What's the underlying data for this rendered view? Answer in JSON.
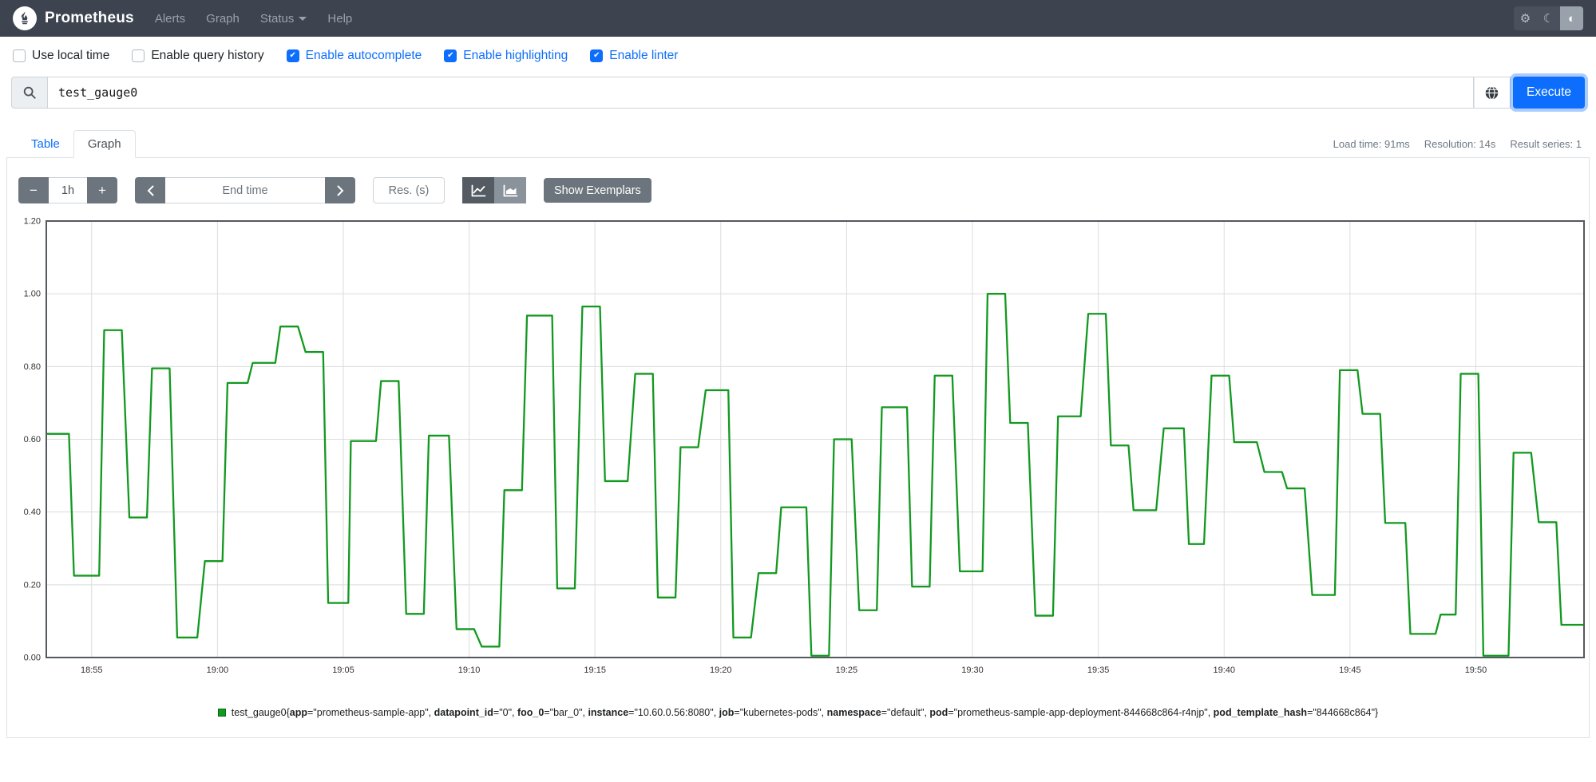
{
  "navbar": {
    "brand": "Prometheus",
    "items": [
      {
        "label": "Alerts"
      },
      {
        "label": "Graph"
      },
      {
        "label": "Status",
        "has_caret": true
      },
      {
        "label": "Help"
      }
    ],
    "theme_buttons": [
      {
        "icon": "gear-icon",
        "glyph": "⚙",
        "active": false
      },
      {
        "icon": "moon-icon",
        "glyph": "☾",
        "active": false
      },
      {
        "icon": "contrast-icon",
        "glyph": "◐",
        "active": true
      }
    ]
  },
  "options": {
    "items": [
      {
        "label": "Use local time",
        "checked": false
      },
      {
        "label": "Enable query history",
        "checked": false
      },
      {
        "label": "Enable autocomplete",
        "checked": true
      },
      {
        "label": "Enable highlighting",
        "checked": true
      },
      {
        "label": "Enable linter",
        "checked": true
      }
    ]
  },
  "query": {
    "value": "test_gauge0",
    "execute_label": "Execute"
  },
  "tabs": [
    {
      "label": "Table",
      "active": false
    },
    {
      "label": "Graph",
      "active": true
    }
  ],
  "stats": {
    "load_time": "Load time: 91ms",
    "resolution": "Resolution: 14s",
    "result_series": "Result series: 1"
  },
  "controls": {
    "minus": "−",
    "range_value": "1h",
    "plus": "+",
    "prev": "‹",
    "end_time_placeholder": "End time",
    "next": "›",
    "res_placeholder": "Res. (s)",
    "show_exemplars": "Show Exemplars"
  },
  "chart_data": {
    "type": "line",
    "step": true,
    "title": "",
    "xlabel": "",
    "ylabel": "",
    "grid": true,
    "legend_position": "bottom-center",
    "xlim_minutes_after_1850": [
      3.2,
      64.3
    ],
    "ylim": [
      0,
      1.2
    ],
    "y_ticks": [
      0,
      0.2,
      0.4,
      0.6,
      0.8,
      1.0,
      1.2
    ],
    "x_ticks": [
      {
        "min": 5,
        "label": "18:55"
      },
      {
        "min": 10,
        "label": "19:00"
      },
      {
        "min": 15,
        "label": "19:05"
      },
      {
        "min": 20,
        "label": "19:10"
      },
      {
        "min": 25,
        "label": "19:15"
      },
      {
        "min": 30,
        "label": "19:20"
      },
      {
        "min": 35,
        "label": "19:25"
      },
      {
        "min": 40,
        "label": "19:30"
      },
      {
        "min": 45,
        "label": "19:35"
      },
      {
        "min": 50,
        "label": "19:40"
      },
      {
        "min": 55,
        "label": "19:45"
      },
      {
        "min": 60,
        "label": "19:50"
      }
    ],
    "series": [
      {
        "name": "test_gauge0",
        "color": "#12991f",
        "segments_start_end_value": [
          [
            3.2,
            4.1,
            0.615
          ],
          [
            4.3,
            5.3,
            0.225
          ],
          [
            5.5,
            6.2,
            0.9
          ],
          [
            6.5,
            7.2,
            0.385
          ],
          [
            7.4,
            8.1,
            0.795
          ],
          [
            8.4,
            9.2,
            0.055
          ],
          [
            9.5,
            10.2,
            0.265
          ],
          [
            10.4,
            11.2,
            0.755
          ],
          [
            11.4,
            12.3,
            0.81
          ],
          [
            12.5,
            13.2,
            0.91
          ],
          [
            13.5,
            14.2,
            0.84
          ],
          [
            14.4,
            15.2,
            0.15
          ],
          [
            15.3,
            16.3,
            0.595
          ],
          [
            16.5,
            17.2,
            0.76
          ],
          [
            17.5,
            18.2,
            0.12
          ],
          [
            18.4,
            19.2,
            0.61
          ],
          [
            19.5,
            20.2,
            0.078
          ],
          [
            20.5,
            21.2,
            0.03
          ],
          [
            21.4,
            22.1,
            0.46
          ],
          [
            22.3,
            23.3,
            0.94
          ],
          [
            23.5,
            24.2,
            0.19
          ],
          [
            24.5,
            25.2,
            0.965
          ],
          [
            25.4,
            26.3,
            0.485
          ],
          [
            26.6,
            27.3,
            0.78
          ],
          [
            27.5,
            28.2,
            0.165
          ],
          [
            28.4,
            29.1,
            0.578
          ],
          [
            29.4,
            30.3,
            0.735
          ],
          [
            30.5,
            31.2,
            0.055
          ],
          [
            31.5,
            32.2,
            0.232
          ],
          [
            32.4,
            33.4,
            0.413
          ],
          [
            33.6,
            34.3,
            0.005
          ],
          [
            34.5,
            35.2,
            0.6
          ],
          [
            35.5,
            36.2,
            0.13
          ],
          [
            36.4,
            37.4,
            0.688
          ],
          [
            37.6,
            38.3,
            0.195
          ],
          [
            38.5,
            39.2,
            0.775
          ],
          [
            39.5,
            40.4,
            0.237
          ],
          [
            40.6,
            41.3,
            1.0
          ],
          [
            41.5,
            42.2,
            0.645
          ],
          [
            42.5,
            43.2,
            0.115
          ],
          [
            43.4,
            44.3,
            0.663
          ],
          [
            44.6,
            45.3,
            0.945
          ],
          [
            45.5,
            46.2,
            0.583
          ],
          [
            46.4,
            47.3,
            0.405
          ],
          [
            47.6,
            48.4,
            0.63
          ],
          [
            48.6,
            49.2,
            0.312
          ],
          [
            49.5,
            50.2,
            0.775
          ],
          [
            50.4,
            51.3,
            0.592
          ],
          [
            51.6,
            52.3,
            0.51
          ],
          [
            52.5,
            53.2,
            0.465
          ],
          [
            53.5,
            54.4,
            0.172
          ],
          [
            54.6,
            55.3,
            0.79
          ],
          [
            55.5,
            56.2,
            0.67
          ],
          [
            56.4,
            57.2,
            0.37
          ],
          [
            57.4,
            58.4,
            0.065
          ],
          [
            58.6,
            59.2,
            0.118
          ],
          [
            59.4,
            60.1,
            0.78
          ],
          [
            60.3,
            61.3,
            0.005
          ],
          [
            61.5,
            62.2,
            0.563
          ],
          [
            62.5,
            63.2,
            0.372
          ],
          [
            63.4,
            64.3,
            0.09
          ]
        ]
      }
    ]
  },
  "legend": {
    "metric": "test_gauge0",
    "labels": [
      {
        "key": "app",
        "value": "prometheus-sample-app"
      },
      {
        "key": "datapoint_id",
        "value": "0"
      },
      {
        "key": "foo_0",
        "value": "bar_0"
      },
      {
        "key": "instance",
        "value": "10.60.0.56:8080"
      },
      {
        "key": "job",
        "value": "kubernetes-pods"
      },
      {
        "key": "namespace",
        "value": "default"
      },
      {
        "key": "pod",
        "value": "prometheus-sample-app-deployment-844668c864-r4njp"
      },
      {
        "key": "pod_template_hash",
        "value": "844668c864"
      }
    ]
  }
}
